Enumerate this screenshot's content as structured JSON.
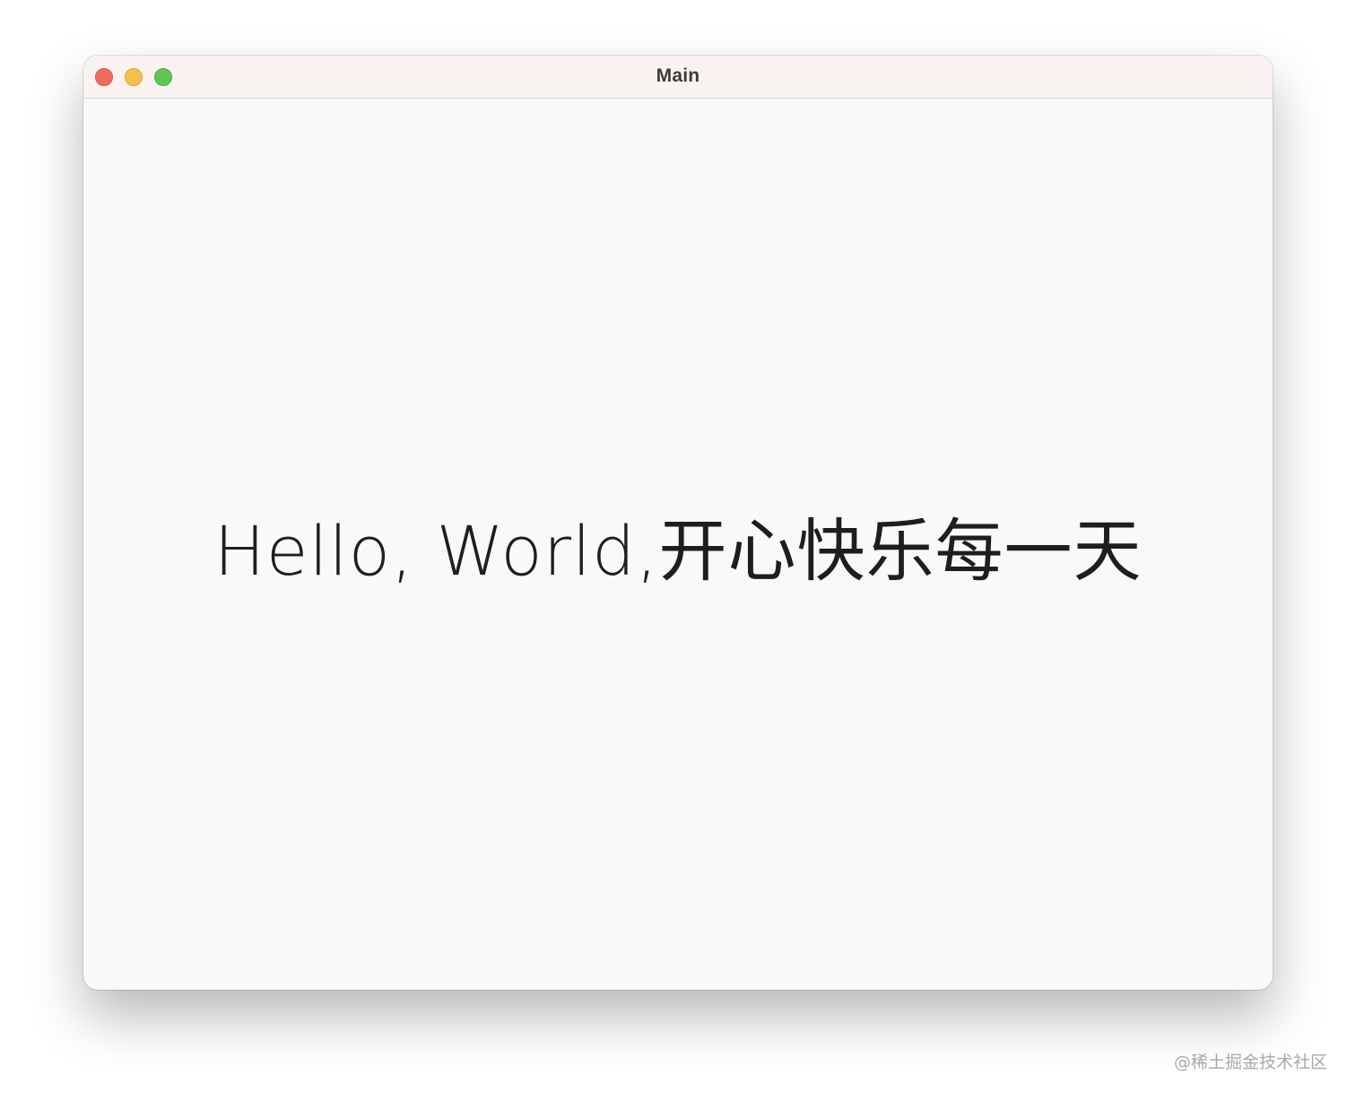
{
  "window": {
    "title": "Main",
    "background": "#f9f9f9",
    "titlebar_background": "#f8f3f0",
    "controls": {
      "close_color": "#ed6a5e",
      "minimize_color": "#f5bf4f",
      "zoom_color": "#61c554"
    }
  },
  "content": {
    "greeting": "Hello, World,开心快乐每一天"
  },
  "watermark": "@稀土掘金技术社区"
}
